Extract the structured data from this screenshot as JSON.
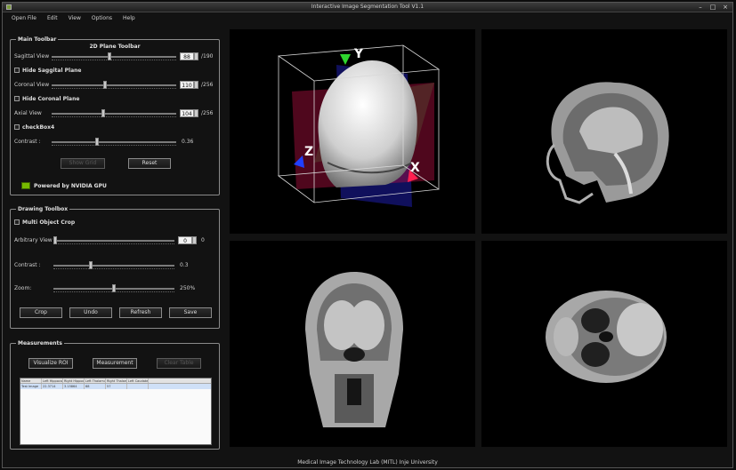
{
  "window": {
    "title": "Interactive Image Segmentation Tool V1.1"
  },
  "menu": {
    "items": [
      "Open File",
      "Edit",
      "View",
      "Options",
      "Help"
    ]
  },
  "main_toolbar": {
    "title": "Main Toolbar",
    "subtitle": "2D Plane Toolbar",
    "sagittal": {
      "label": "Sagittal View",
      "value": "88",
      "max": "/190",
      "level": 0.46
    },
    "hide_sagittal": "Hide Saggital Plane",
    "coronal": {
      "label": "Coronal View",
      "value": "110",
      "max": "/256",
      "level": 0.43
    },
    "hide_coronal": "Hide Coronal Plane",
    "axial": {
      "label": "Axial View",
      "value": "104",
      "max": "/256",
      "level": 0.41
    },
    "checkbox4": "checkBox4",
    "contrast": {
      "label": "Contrast :",
      "value": "0.36",
      "level": 0.36
    },
    "btn_disabled": "Show Grid",
    "reset": "Reset",
    "nvidia": "Powered by NVIDIA GPU"
  },
  "drawing_toolbox": {
    "title": "Drawing Toolbox",
    "multi_object": "Multi Object Crop",
    "arbitrary": {
      "label": "Arbitrary View",
      "value": "0",
      "max": "0",
      "level": 0.0
    },
    "contrast": {
      "label": "Contrast :",
      "value": "0.3",
      "level": 0.3
    },
    "zoom": {
      "label": "Zoom:",
      "value": "250%",
      "level": 0.5
    },
    "buttons": [
      "Crop",
      "Undo",
      "Refresh",
      "Save"
    ]
  },
  "measurements": {
    "title": "Measurements",
    "buttons": [
      "Visualize ROI",
      "Measurement",
      "Clear Table"
    ],
    "table": {
      "headers": [
        "Name",
        "Left Hippocampus Vol.",
        "Right Hippocampus Vol.",
        "Left Thalamus Vol.",
        "Right Thalamus Vol.",
        "Left Caudate Vol."
      ],
      "rows": [
        [
          "Test Image",
          "22.3714",
          "3.15864",
          "68",
          "57",
          ""
        ]
      ]
    }
  },
  "viewer": {
    "axis_labels": {
      "y": "Y",
      "z": "Z",
      "x": "X"
    }
  },
  "status": {
    "text": "Medical Image Technology Lab (MITL) Inje University"
  },
  "colors": {
    "plane_red": "#b01040",
    "plane_blue": "#1a1a9a",
    "plane_green": "#106020",
    "nvidia_green": "#76b900"
  }
}
